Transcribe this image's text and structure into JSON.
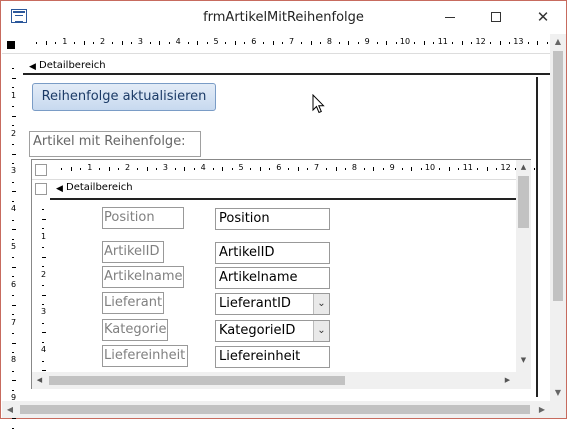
{
  "window": {
    "title": "frmArtikelMitReihenfolge",
    "controls": {
      "minimize": "—",
      "maximize": "☐",
      "close": "✕"
    }
  },
  "ruler_top": [
    "1",
    "2",
    "3",
    "4",
    "5",
    "6",
    "7",
    "8",
    "9",
    "10",
    "11",
    "12",
    "13"
  ],
  "ruler_left": [
    "1",
    "2",
    "3",
    "4",
    "5",
    "6",
    "7",
    "8",
    "9"
  ],
  "section": {
    "label": "Detailbereich"
  },
  "update_button": {
    "label": "Reihenfolge aktualisieren"
  },
  "subform_label": {
    "text": "Artikel mit Reihenfolge:"
  },
  "subform": {
    "ruler_top": [
      "1",
      "2",
      "3",
      "4",
      "5",
      "6",
      "7",
      "8",
      "9",
      "10",
      "11",
      "12"
    ],
    "ruler_left": [
      "1",
      "2",
      "3",
      "4"
    ],
    "section_label": "Detailbereich",
    "fields": [
      {
        "label": "Position",
        "value": "Position",
        "combo": false
      },
      {
        "label": "ArtikelID",
        "value": "ArtikelID",
        "combo": false
      },
      {
        "label": "Artikelname",
        "value": "Artikelname",
        "combo": false
      },
      {
        "label": "Lieferant",
        "value": "LieferantID",
        "combo": true
      },
      {
        "label": "Kategorie",
        "value": "KategorieID",
        "combo": true
      },
      {
        "label": "Liefereinheit",
        "value": "Liefereinheit",
        "combo": false
      }
    ]
  },
  "colors": {
    "accent_border": "#c76b5e",
    "button_bg": "#c7d9ef",
    "button_text": "#1b3a66"
  }
}
